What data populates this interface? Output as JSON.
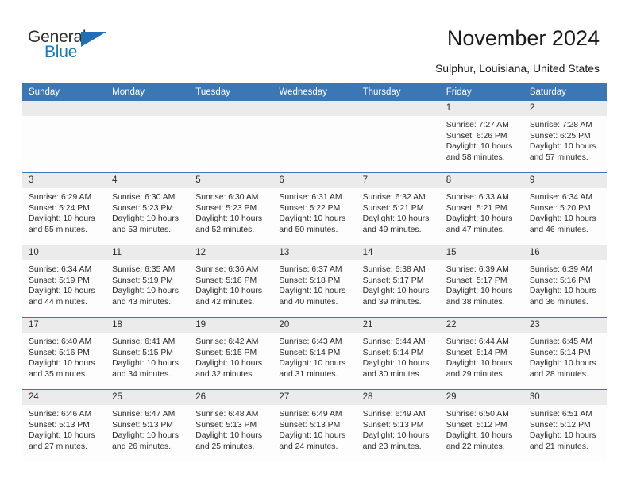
{
  "brand": {
    "name_top": "General",
    "name_bottom": "Blue",
    "triangle_icon": "triangle-icon",
    "accent_color": "#1878be"
  },
  "header": {
    "title": "November 2024",
    "subtitle": "Sulphur, Louisiana, United States"
  },
  "theme": {
    "header_blue": "#3b77b5",
    "daynum_gray": "#ebebeb",
    "cell_bg": "#fdfdfd",
    "text": "#2b2b2b"
  },
  "calendar": {
    "weekday_headers": [
      "Sunday",
      "Monday",
      "Tuesday",
      "Wednesday",
      "Thursday",
      "Friday",
      "Saturday"
    ],
    "weeks": [
      [
        {
          "day": "",
          "empty": true
        },
        {
          "day": "",
          "empty": true
        },
        {
          "day": "",
          "empty": true
        },
        {
          "day": "",
          "empty": true
        },
        {
          "day": "",
          "empty": true
        },
        {
          "day": "1",
          "sunrise": "Sunrise: 7:27 AM",
          "sunset": "Sunset: 6:26 PM",
          "daylight": "Daylight: 10 hours and 58 minutes."
        },
        {
          "day": "2",
          "sunrise": "Sunrise: 7:28 AM",
          "sunset": "Sunset: 6:25 PM",
          "daylight": "Daylight: 10 hours and 57 minutes."
        }
      ],
      [
        {
          "day": "3",
          "sunrise": "Sunrise: 6:29 AM",
          "sunset": "Sunset: 5:24 PM",
          "daylight": "Daylight: 10 hours and 55 minutes."
        },
        {
          "day": "4",
          "sunrise": "Sunrise: 6:30 AM",
          "sunset": "Sunset: 5:23 PM",
          "daylight": "Daylight: 10 hours and 53 minutes."
        },
        {
          "day": "5",
          "sunrise": "Sunrise: 6:30 AM",
          "sunset": "Sunset: 5:23 PM",
          "daylight": "Daylight: 10 hours and 52 minutes."
        },
        {
          "day": "6",
          "sunrise": "Sunrise: 6:31 AM",
          "sunset": "Sunset: 5:22 PM",
          "daylight": "Daylight: 10 hours and 50 minutes."
        },
        {
          "day": "7",
          "sunrise": "Sunrise: 6:32 AM",
          "sunset": "Sunset: 5:21 PM",
          "daylight": "Daylight: 10 hours and 49 minutes."
        },
        {
          "day": "8",
          "sunrise": "Sunrise: 6:33 AM",
          "sunset": "Sunset: 5:21 PM",
          "daylight": "Daylight: 10 hours and 47 minutes."
        },
        {
          "day": "9",
          "sunrise": "Sunrise: 6:34 AM",
          "sunset": "Sunset: 5:20 PM",
          "daylight": "Daylight: 10 hours and 46 minutes."
        }
      ],
      [
        {
          "day": "10",
          "sunrise": "Sunrise: 6:34 AM",
          "sunset": "Sunset: 5:19 PM",
          "daylight": "Daylight: 10 hours and 44 minutes."
        },
        {
          "day": "11",
          "sunrise": "Sunrise: 6:35 AM",
          "sunset": "Sunset: 5:19 PM",
          "daylight": "Daylight: 10 hours and 43 minutes."
        },
        {
          "day": "12",
          "sunrise": "Sunrise: 6:36 AM",
          "sunset": "Sunset: 5:18 PM",
          "daylight": "Daylight: 10 hours and 42 minutes."
        },
        {
          "day": "13",
          "sunrise": "Sunrise: 6:37 AM",
          "sunset": "Sunset: 5:18 PM",
          "daylight": "Daylight: 10 hours and 40 minutes."
        },
        {
          "day": "14",
          "sunrise": "Sunrise: 6:38 AM",
          "sunset": "Sunset: 5:17 PM",
          "daylight": "Daylight: 10 hours and 39 minutes."
        },
        {
          "day": "15",
          "sunrise": "Sunrise: 6:39 AM",
          "sunset": "Sunset: 5:17 PM",
          "daylight": "Daylight: 10 hours and 38 minutes."
        },
        {
          "day": "16",
          "sunrise": "Sunrise: 6:39 AM",
          "sunset": "Sunset: 5:16 PM",
          "daylight": "Daylight: 10 hours and 36 minutes."
        }
      ],
      [
        {
          "day": "17",
          "sunrise": "Sunrise: 6:40 AM",
          "sunset": "Sunset: 5:16 PM",
          "daylight": "Daylight: 10 hours and 35 minutes."
        },
        {
          "day": "18",
          "sunrise": "Sunrise: 6:41 AM",
          "sunset": "Sunset: 5:15 PM",
          "daylight": "Daylight: 10 hours and 34 minutes."
        },
        {
          "day": "19",
          "sunrise": "Sunrise: 6:42 AM",
          "sunset": "Sunset: 5:15 PM",
          "daylight": "Daylight: 10 hours and 32 minutes."
        },
        {
          "day": "20",
          "sunrise": "Sunrise: 6:43 AM",
          "sunset": "Sunset: 5:14 PM",
          "daylight": "Daylight: 10 hours and 31 minutes."
        },
        {
          "day": "21",
          "sunrise": "Sunrise: 6:44 AM",
          "sunset": "Sunset: 5:14 PM",
          "daylight": "Daylight: 10 hours and 30 minutes."
        },
        {
          "day": "22",
          "sunrise": "Sunrise: 6:44 AM",
          "sunset": "Sunset: 5:14 PM",
          "daylight": "Daylight: 10 hours and 29 minutes."
        },
        {
          "day": "23",
          "sunrise": "Sunrise: 6:45 AM",
          "sunset": "Sunset: 5:14 PM",
          "daylight": "Daylight: 10 hours and 28 minutes."
        }
      ],
      [
        {
          "day": "24",
          "sunrise": "Sunrise: 6:46 AM",
          "sunset": "Sunset: 5:13 PM",
          "daylight": "Daylight: 10 hours and 27 minutes."
        },
        {
          "day": "25",
          "sunrise": "Sunrise: 6:47 AM",
          "sunset": "Sunset: 5:13 PM",
          "daylight": "Daylight: 10 hours and 26 minutes."
        },
        {
          "day": "26",
          "sunrise": "Sunrise: 6:48 AM",
          "sunset": "Sunset: 5:13 PM",
          "daylight": "Daylight: 10 hours and 25 minutes."
        },
        {
          "day": "27",
          "sunrise": "Sunrise: 6:49 AM",
          "sunset": "Sunset: 5:13 PM",
          "daylight": "Daylight: 10 hours and 24 minutes."
        },
        {
          "day": "28",
          "sunrise": "Sunrise: 6:49 AM",
          "sunset": "Sunset: 5:13 PM",
          "daylight": "Daylight: 10 hours and 23 minutes."
        },
        {
          "day": "29",
          "sunrise": "Sunrise: 6:50 AM",
          "sunset": "Sunset: 5:12 PM",
          "daylight": "Daylight: 10 hours and 22 minutes."
        },
        {
          "day": "30",
          "sunrise": "Sunrise: 6:51 AM",
          "sunset": "Sunset: 5:12 PM",
          "daylight": "Daylight: 10 hours and 21 minutes."
        }
      ]
    ]
  }
}
